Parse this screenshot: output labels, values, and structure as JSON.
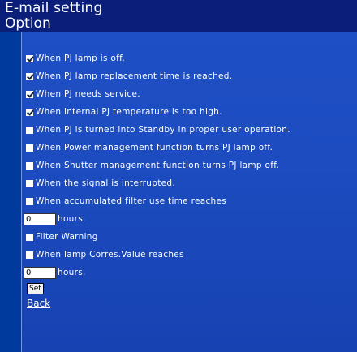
{
  "header": {
    "title": "E-mail setting",
    "subtitle": "Option"
  },
  "options": [
    {
      "label": "When PJ lamp is off.",
      "checked": true
    },
    {
      "label": "When PJ lamp replacement time is reached.",
      "checked": true
    },
    {
      "label": "When PJ needs service.",
      "checked": true
    },
    {
      "label": "When internal PJ temperature is too high.",
      "checked": true
    },
    {
      "label": "When PJ is turned into Standby in proper user operation.",
      "checked": false
    },
    {
      "label": "When Power management function turns PJ lamp off.",
      "checked": false
    },
    {
      "label": "When Shutter management function turns PJ lamp off.",
      "checked": false
    },
    {
      "label": "When the signal is interrupted.",
      "checked": false
    },
    {
      "label": "When accumulated filter use time reaches",
      "checked": false
    },
    {
      "label": "Filter Warning",
      "checked": false
    },
    {
      "label": "When lamp Corres.Value reaches",
      "checked": false
    }
  ],
  "filter_hours": {
    "value": "0",
    "unit": "hours."
  },
  "lamp_hours": {
    "value": "0",
    "unit": "hours."
  },
  "set_button": "Set",
  "back_link": "Back"
}
